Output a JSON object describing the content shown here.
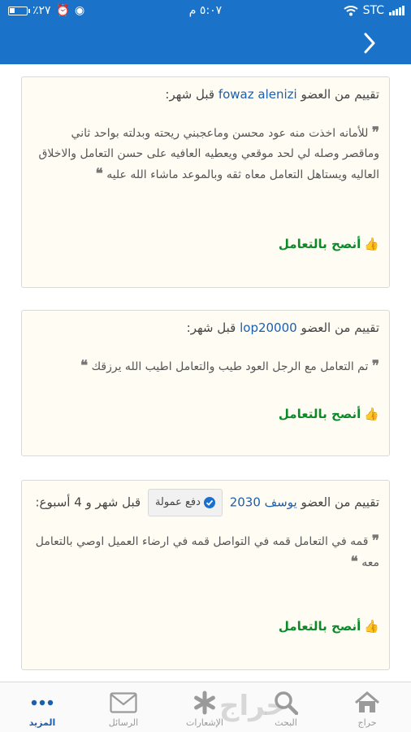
{
  "status": {
    "battery": "٪٢٧",
    "time": "٥:٠٧ م",
    "carrier": "STC"
  },
  "reviews": [
    {
      "prefix": "تقييم من العضو",
      "member": "fowaz alenizi",
      "badge": "",
      "when": "قبل شهر:",
      "text": "للأمانه اخذت منه عود محسن وماعجبني ريحته وبدلته بواحد ثاني وماقصر وصله لي لحد موقعي ويعطيه العافيه على حسن التعامل والاخلاق العاليه ويستاهل التعامل معاه ثقه وبالموعد ماشاء الله عليه",
      "recommend": "أنصح بالتعامل"
    },
    {
      "prefix": "تقييم من العضو",
      "member": "lop20000",
      "badge": "",
      "when": "قبل شهر:",
      "text": "تم التعامل مع الرجل العود طيب والتعامل اطيب الله يرزقك",
      "recommend": "أنصح بالتعامل"
    },
    {
      "prefix": "تقييم من العضو",
      "member": "يوسف 2030",
      "badge": "دفع عمولة",
      "when": "قبل شهر و 4 أسبوع:",
      "text": "قمه في التعامل قمه في التواصل قمه في ارضاء العميل اوصي بالتعامل معه",
      "recommend": "أنصح بالتعامل"
    }
  ],
  "tabs": [
    {
      "label": "المزيد",
      "icon": "more-icon"
    },
    {
      "label": "الرسائل",
      "icon": "mail-icon"
    },
    {
      "label": "الإشعارات",
      "icon": "asterisk-icon"
    },
    {
      "label": "البحث",
      "icon": "search-icon"
    },
    {
      "label": "حراج",
      "icon": "home-icon"
    }
  ],
  "watermark": "حراج",
  "colors": {
    "header": "#1a73c9",
    "link": "#1b5fae",
    "recommend": "#0b8a2a",
    "card_bg": "#fffdf3"
  }
}
